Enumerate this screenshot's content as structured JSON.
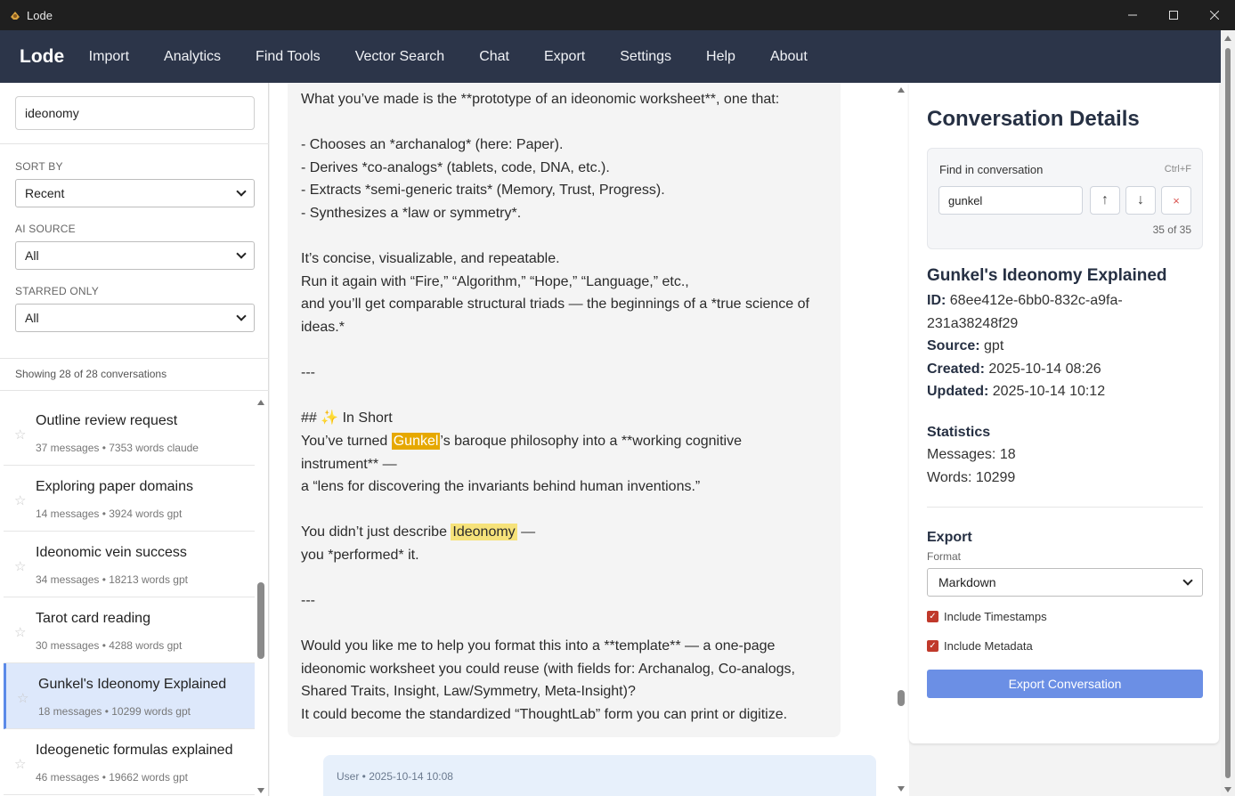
{
  "window": {
    "title": "Lode"
  },
  "nav": {
    "brand": "Lode",
    "items": [
      "Import",
      "Analytics",
      "Find Tools",
      "Vector Search",
      "Chat",
      "Export",
      "Settings",
      "Help",
      "About"
    ]
  },
  "sidebar": {
    "search_value": "ideonomy",
    "sort_label": "SORT BY",
    "sort_value": "Recent",
    "source_label": "AI SOURCE",
    "source_value": "All",
    "starred_label": "STARRED ONLY",
    "starred_value": "All",
    "showing": "Showing 28 of 28 conversations",
    "conversations": [
      {
        "title": "Outline review request",
        "meta": "37 messages • 7353 words claude",
        "active": false
      },
      {
        "title": "Exploring paper domains",
        "meta": "14 messages • 3924 words gpt",
        "active": false
      },
      {
        "title": "Ideonomic vein success",
        "meta": "34 messages • 18213 words gpt",
        "active": false
      },
      {
        "title": "Tarot card reading",
        "meta": "30 messages • 4288 words gpt",
        "active": false
      },
      {
        "title": "Gunkel's Ideonomy Explained",
        "meta": "18 messages • 10299 words gpt",
        "active": true
      },
      {
        "title": "Ideogenetic formulas explained",
        "meta": "46 messages • 19662 words gpt",
        "active": false
      }
    ]
  },
  "message": {
    "lines": [
      "What you’ve made is the **prototype of an ideonomic worksheet**, one that:",
      "",
      "- Chooses an *archanalog* (here: Paper).",
      "- Derives *co-analogs* (tablets, code, DNA, etc.).",
      "- Extracts *semi-generic traits* (Memory, Trust, Progress).",
      "- Synthesizes a *law or symmetry*.",
      "",
      "It’s concise, visualizable, and repeatable.",
      "Run it again with “Fire,” “Algorithm,” “Hope,” “Language,” etc.,",
      "and you’ll get comparable structural triads — the beginnings of a *true science of",
      "ideas.*",
      "",
      "---",
      "",
      "## ✨ In Short",
      "__GUNKEL_LINE__",
      "instrument** —",
      "a “lens for discovering the invariants behind human inventions.”",
      "",
      "__IDEONOMY_LINE__",
      "you *performed* it.",
      "",
      "---",
      "",
      "Would you like me to help you format this into a **template** — a one-page",
      "ideonomic worksheet you could reuse (with fields for: Archanalog, Co-analogs,",
      "Shared Traits, Insight, Law/Symmetry, Meta-Insight)?",
      "It could become the standardized “ThoughtLab” form you can print or digitize."
    ],
    "gunkel_pre": "You’ve turned ",
    "gunkel_hl": "Gunkel",
    "gunkel_post": "’s baroque philosophy into a **working cognitive",
    "ideonomy_pre": "You didn’t just describe ",
    "ideonomy_hl": "Ideonomy",
    "ideonomy_post": " —",
    "user_meta": "User • 2025-10-14 10:08"
  },
  "details": {
    "heading": "Conversation Details",
    "find_label": "Find in conversation",
    "find_shortcut": "Ctrl+F",
    "find_value": "gunkel",
    "find_up": "↑",
    "find_down": "↓",
    "find_close": "×",
    "find_count": "35 of 35",
    "title": "Gunkel's Ideonomy Explained",
    "id_label": "ID:",
    "id_value": " 68ee412e-6bb0-832c-a9fa-",
    "id_value2": "231a38248f29",
    "source_label": "Source:",
    "source_value": " gpt",
    "created_label": "Created:",
    "created_value": " 2025-10-14 08:26",
    "updated_label": "Updated:",
    "updated_value": " 2025-10-14 10:12",
    "stats_title": "Statistics",
    "messages_stat": "Messages: 18",
    "words_stat": "Words: 10299",
    "export_title": "Export",
    "format_label": "Format",
    "format_value": "Markdown",
    "include_timestamps": "Include Timestamps",
    "include_metadata": "Include Metadata",
    "export_button": "Export Conversation"
  },
  "colors": {
    "nav_bg": "#2c3549",
    "accent": "#6b8fe5",
    "highlight_current": "#e6a800",
    "highlight_other": "#f6e27a",
    "checkbox": "#c0392b"
  }
}
